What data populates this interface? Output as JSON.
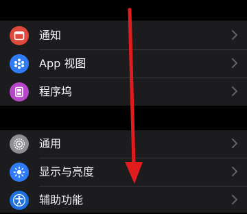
{
  "colors": {
    "background": "#000000",
    "group_bg": "#1c1c1e",
    "text": "#f2f2f7",
    "separator": "#38383a",
    "chevron": "#636366",
    "arrow": "#e21c1c"
  },
  "groups": [
    {
      "items": [
        {
          "label": "通知",
          "icon": "notifications-icon",
          "icon_color": "#e0483e"
        },
        {
          "label": "App 视图",
          "icon": "app-grid-icon",
          "icon_color": "#2f7cf6"
        },
        {
          "label": "程序坞",
          "icon": "dock-icon",
          "icon_color": "#b548c6"
        }
      ]
    },
    {
      "items": [
        {
          "label": "通用",
          "icon": "gear-icon",
          "icon_color": "#8e8e93"
        },
        {
          "label": "显示与亮度",
          "icon": "brightness-icon",
          "icon_color": "#2f7cf6"
        },
        {
          "label": "辅助功能",
          "icon": "accessibility-icon",
          "icon_color": "#1e6fe0"
        }
      ]
    }
  ],
  "annotation": {
    "type": "arrow",
    "direction": "down",
    "icon": "red-arrow-annotation"
  }
}
